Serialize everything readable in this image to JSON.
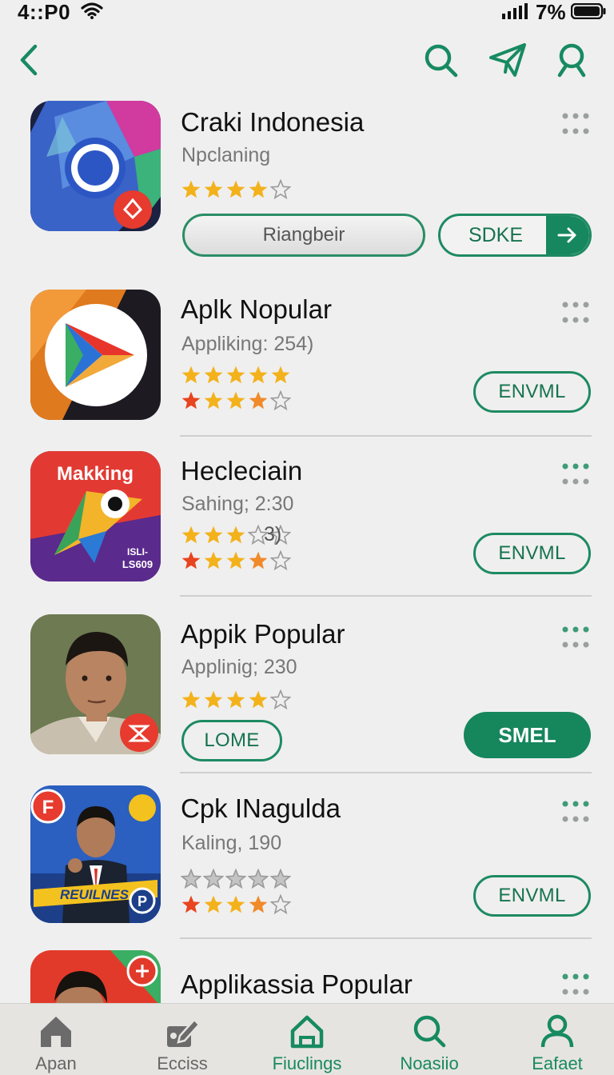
{
  "status_bar": {
    "time": "4::P0",
    "battery": "7%"
  },
  "apps": [
    {
      "title": "Craki Indonesia",
      "subtitle": "Npclaning",
      "rating_row1": 4,
      "rating_row2": null,
      "rating_note": "",
      "primary_button": "Riangbeir",
      "secondary_button": "SDKE",
      "button_style": "split"
    },
    {
      "title": "Aplk Nopular",
      "subtitle": "Appliking: 254)",
      "rating_row1": 5,
      "rating_row2": 4,
      "rating_note": "",
      "primary_button": "ENVML",
      "button_style": "outline"
    },
    {
      "title": "Heclеciain",
      "subtitle": "Sahing; 2:30",
      "rating_row1": 3,
      "rating_row2": 4,
      "rating_note": "3)",
      "primary_button": "ENVML",
      "button_style": "outline",
      "icon_text": "Makking",
      "icon_badge": "ISLI-\nLS609"
    },
    {
      "title": "Appik Popular",
      "subtitle": "Applinig; 230",
      "rating_row1": 4,
      "rating_row2": null,
      "rating_note": "",
      "primary_button": "LOME",
      "secondary_button": "SMEL",
      "button_style": "pair"
    },
    {
      "title": "Cpk INagulda",
      "subtitle": "Kaling, 190",
      "rating_row1": 0,
      "rating_row2": 4,
      "rating_note": "",
      "primary_button": "ENVML",
      "button_style": "outline",
      "icon_text": "REUILNES",
      "icon_badge": "F"
    },
    {
      "title": "Applikassia Popular",
      "subtitle": "",
      "rating_row1": null,
      "rating_row2": null,
      "primary_button": "",
      "button_style": "none"
    }
  ],
  "bottom_nav": [
    {
      "label": "Apan",
      "icon": "home-icon"
    },
    {
      "label": "Ecciss",
      "icon": "edit-icon"
    },
    {
      "label": "Fiuclings",
      "icon": "home-icon"
    },
    {
      "label": "Noasiio",
      "icon": "search-icon"
    },
    {
      "label": "Eafaet",
      "icon": "user-icon"
    }
  ],
  "colors": {
    "accent": "#16865d",
    "star": "#f3b21c",
    "star_red": "#e8441f",
    "background": "#efefef"
  }
}
